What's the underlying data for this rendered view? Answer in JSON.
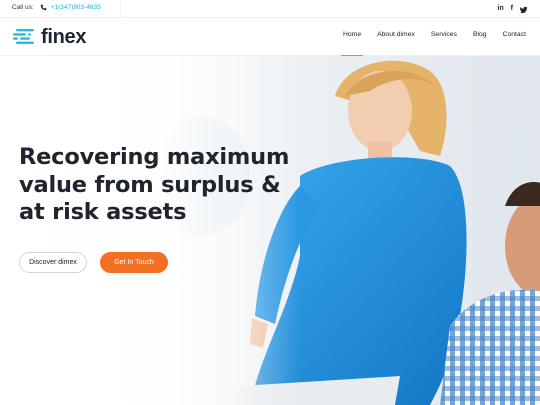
{
  "topbar": {
    "call_label": "Call us:",
    "phone_number": "+1(347)903-4635",
    "social": [
      {
        "icon": "linkedin-icon",
        "glyph": "in"
      },
      {
        "icon": "facebook-icon",
        "glyph": "f"
      },
      {
        "icon": "twitter-icon",
        "glyph": "🐦"
      }
    ]
  },
  "header": {
    "logo_text": "finex",
    "nav": [
      {
        "label": "Home",
        "active": true
      },
      {
        "label": "About dimex",
        "active": false
      },
      {
        "label": "Services",
        "active": false
      },
      {
        "label": "Blog",
        "active": false
      },
      {
        "label": "Contact",
        "active": false
      }
    ]
  },
  "hero": {
    "title_lines": [
      "Recovering maximum",
      "value from surplus &",
      "at risk assets"
    ],
    "primary_button": "Discover dimex",
    "secondary_button": "Get In Touch"
  },
  "colors": {
    "accent": "#2dc3e8",
    "orange": "#f36f21",
    "shirt_blue": "#1d95e0",
    "heading": "#20242c"
  }
}
